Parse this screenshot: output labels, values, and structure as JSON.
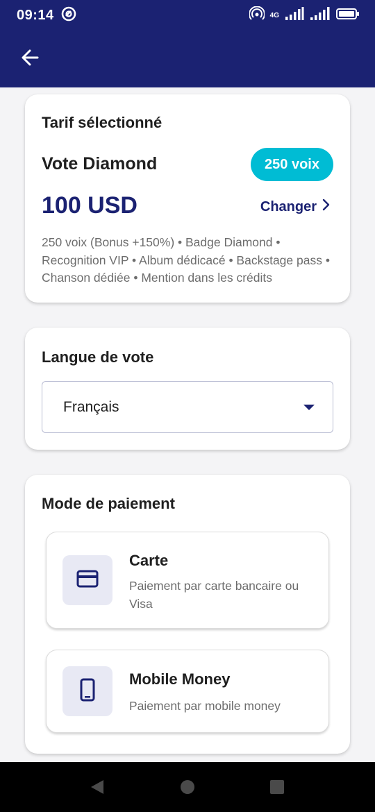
{
  "status_bar": {
    "time": "09:14",
    "network": "4G",
    "icons": [
      "vpn-key-icon",
      "hotspot-icon",
      "signal-icon",
      "signal-icon",
      "battery-icon"
    ]
  },
  "app_bar": {
    "back_icon": "arrow-left-icon"
  },
  "tariff": {
    "title": "Tarif sélectionné",
    "plan_name": "Vote Diamond",
    "badge": "250 voix",
    "price": "100 USD",
    "change_label": "Changer",
    "description": "250 voix (Bonus +150%) • Badge Diamond • Recognition VIP • Album dédicacé • Backstage pass • Chanson dédiée • Mention dans les crédits"
  },
  "language": {
    "title": "Langue de vote",
    "selected": "Français"
  },
  "payment": {
    "title": "Mode de paiement",
    "options": [
      {
        "title": "Carte",
        "description": "Paiement par carte bancaire ou Visa",
        "icon": "credit-card-icon"
      },
      {
        "title": "Mobile Money",
        "description": "Paiement par mobile money",
        "icon": "smartphone-icon"
      }
    ]
  },
  "nav_bar": {
    "icons": [
      "back-triangle-icon",
      "home-circle-icon",
      "recents-square-icon"
    ]
  },
  "colors": {
    "primary": "#1b2272",
    "accent": "#00bcd4",
    "background": "#f4f4f6",
    "icon_bg": "#e8e9f4"
  }
}
